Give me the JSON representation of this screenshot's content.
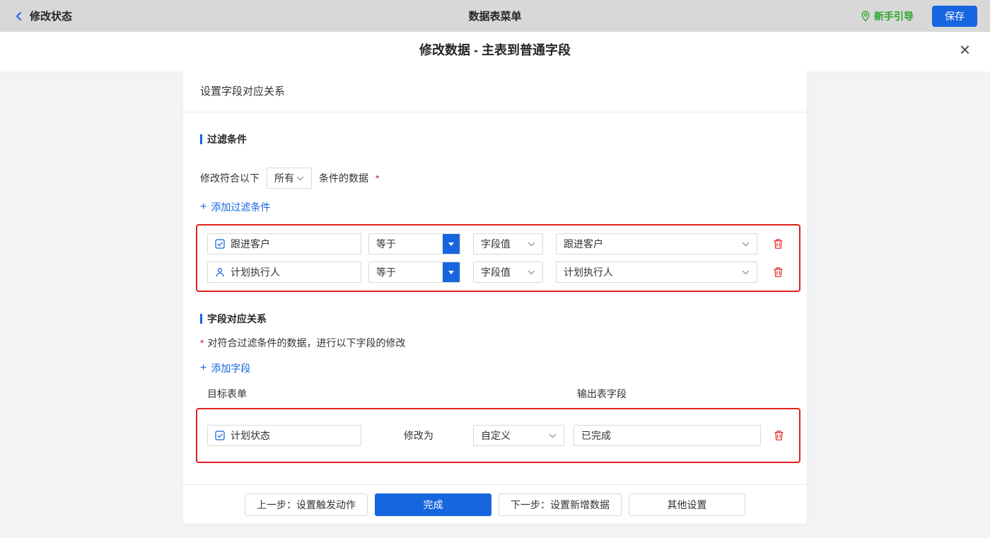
{
  "colors": {
    "accent": "#1766e0",
    "danger": "#e01f1f",
    "success": "#27a427",
    "topbar_bg": "#d8d8d8"
  },
  "topbar": {
    "back_label": "修改状态",
    "title": "数据表菜单",
    "guide_label": "新手引导",
    "save_label": "保存"
  },
  "dialog": {
    "title": "修改数据 - 主表到普通字段",
    "close": "×"
  },
  "panel": {
    "header": "设置字段对应关系"
  },
  "filter": {
    "section_title": "过滤条件",
    "condition_prefix": "修改符合以下",
    "match_value": "所有",
    "condition_suffix": "条件的数据",
    "required": "*",
    "add_plus": "+",
    "add_label": "添加过滤条件",
    "rows": [
      {
        "field": "跟进客户",
        "operator": "等于",
        "value_type": "字段值",
        "value": "跟进客户"
      },
      {
        "field": "计划执行人",
        "operator": "等于",
        "value_type": "字段值",
        "value": "计划执行人"
      }
    ]
  },
  "mapping": {
    "section_title": "字段对应关系",
    "required": "*",
    "description": "对符合过滤条件的数据，进行以下字段的修改",
    "add_plus": "+",
    "add_label": "添加字段",
    "col_target": "目标表单",
    "col_output": "输出表字段",
    "rows": [
      {
        "field": "计划状态",
        "action_label": "修改为",
        "mode": "自定义",
        "value": "已完成"
      }
    ]
  },
  "footer": {
    "prev": "上一步：设置触发动作",
    "done": "完成",
    "next": "下一步：设置新增数据",
    "other": "其他设置"
  }
}
